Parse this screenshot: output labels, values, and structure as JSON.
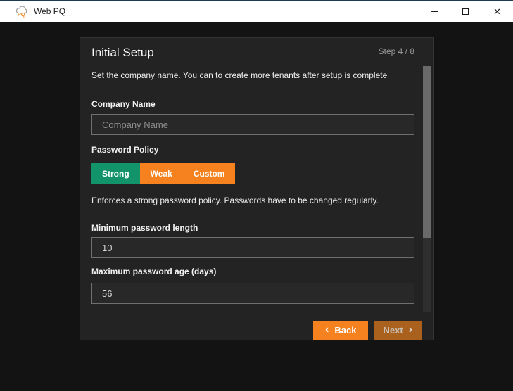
{
  "window": {
    "title": "Web PQ",
    "logo_text": "PQ"
  },
  "icons": {
    "close": "✕",
    "back_chevron": "‹",
    "next_chevron": "›"
  },
  "wizard": {
    "title": "Initial Setup",
    "step": "Step 4 / 8",
    "subtitle": "Set the company name. You can to create more tenants after setup is complete",
    "fields": {
      "company_name": {
        "label": "Company Name",
        "placeholder": "Company Name",
        "value": ""
      },
      "min_length": {
        "label": "Minimum password length",
        "value": "10"
      },
      "max_age": {
        "label": "Maximum password age (days)",
        "value": "56"
      }
    },
    "password_policy": {
      "label": "Password Policy",
      "options": [
        "Strong",
        "Weak",
        "Custom"
      ],
      "selected": "Strong",
      "description": "Enforces a strong password policy. Passwords have to be changed regularly."
    },
    "buttons": {
      "back": "Back",
      "next": "Next"
    }
  },
  "colors": {
    "accent_orange": "#f5821f",
    "policy_green": "#12936a",
    "next_disabled_bg": "#a9611d",
    "panel_bg": "#232323",
    "window_bg": "#131313"
  }
}
